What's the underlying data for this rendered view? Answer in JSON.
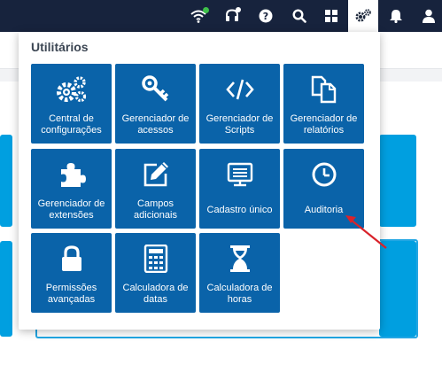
{
  "topbar": {
    "icons": [
      "wifi-icon",
      "headset-icon",
      "help-icon",
      "search-icon",
      "apps-grid-icon",
      "settings-cogs-icon",
      "bell-icon",
      "user-icon"
    ],
    "help_glyph": "?"
  },
  "popup": {
    "title": "Utilitários",
    "tiles": [
      {
        "label": "Central de configurações",
        "icon": "cogs-icon"
      },
      {
        "label": "Gerenciador de acessos",
        "icon": "key-icon"
      },
      {
        "label": "Gerenciador de Scripts",
        "icon": "code-icon"
      },
      {
        "label": "Gerenciador de relatórios",
        "icon": "copy-documents-icon"
      },
      {
        "label": "Gerenciador de extensões",
        "icon": "puzzle-icon"
      },
      {
        "label": "Campos adicionais",
        "icon": "edit-icon"
      },
      {
        "label": "Cadastro único",
        "icon": "list-card-icon"
      },
      {
        "label": "Auditoria",
        "icon": "clock-icon"
      },
      {
        "label": "Permissões avançadas",
        "icon": "lock-icon"
      },
      {
        "label": "Calculadora de datas",
        "icon": "calculator-icon"
      },
      {
        "label": "Calculadora de horas",
        "icon": "hourglass-icon"
      }
    ]
  },
  "colors": {
    "topbar": "#17233d",
    "tile": "#0a63a9",
    "background_card": "#009fe0",
    "annotation_arrow": "#d9232b"
  }
}
